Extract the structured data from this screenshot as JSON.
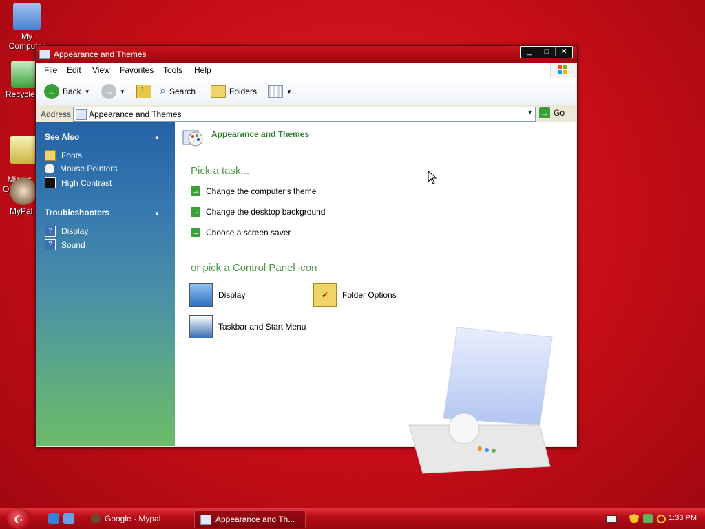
{
  "desktop": {
    "icons": [
      {
        "label": "My Computer",
        "icon": "my-computer-icon"
      },
      {
        "label": "Recycle",
        "icon": "recycle-bin-icon"
      },
      {
        "label": "Micros\nOutlo",
        "icon": "outlook-icon"
      },
      {
        "label": "MyPal",
        "icon": "mypal-icon"
      }
    ]
  },
  "window": {
    "title": "Appearance and Themes",
    "controls": {
      "minimize": "_",
      "maximize": "□",
      "close": "✕"
    },
    "menu": [
      "File",
      "Edit",
      "View",
      "Favorites",
      "Tools",
      "Help"
    ],
    "toolbar": {
      "back": "Back",
      "search": "Search",
      "folders": "Folders"
    },
    "address": {
      "label": "Address",
      "value": "Appearance and Themes",
      "go": "Go"
    }
  },
  "sidebar": {
    "see_also": {
      "title": "See Also",
      "items": [
        "Fonts",
        "Mouse Pointers",
        "High Contrast"
      ]
    },
    "troubleshooters": {
      "title": "Troubleshooters",
      "items": [
        "Display",
        "Sound"
      ]
    }
  },
  "content": {
    "title": "Appearance and Themes",
    "pick_task": "Pick a task...",
    "tasks": [
      "Change the computer's theme",
      "Change the desktop background",
      "Choose a screen saver"
    ],
    "pick_icon": "or pick a Control Panel icon",
    "icons": [
      "Display",
      "Folder Options",
      "Taskbar and Start Menu"
    ]
  },
  "taskbar": {
    "tasks": [
      "Google - Mypal",
      "Appearance and Th..."
    ],
    "clock": "1:33 PM"
  },
  "colors": {
    "desktop": "#c50d18",
    "titlebar": "#b10a13",
    "link_green": "#2e7d32"
  }
}
